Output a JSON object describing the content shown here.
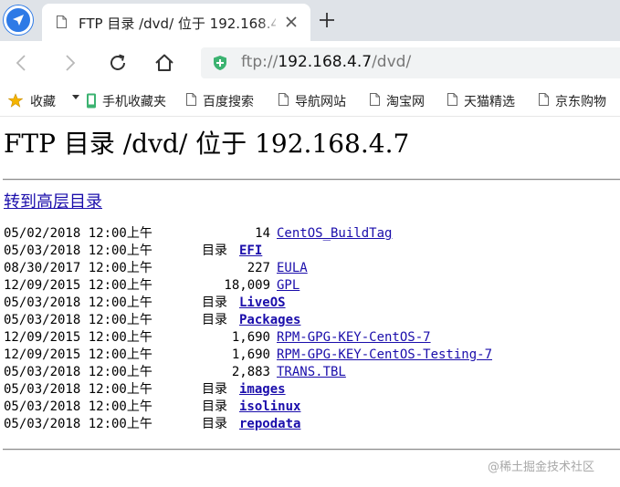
{
  "tab": {
    "title": "FTP 目录 /dvd/ 位于 192.168.4.7"
  },
  "address": {
    "scheme": "ftp://",
    "host": "192.168.4.7",
    "path": "/dvd/"
  },
  "bookmarks": [
    {
      "label": "收藏",
      "icon": "star-icon"
    },
    {
      "label": "手机收藏夹",
      "icon": "phone-icon"
    },
    {
      "label": "百度搜索",
      "icon": "page-icon"
    },
    {
      "label": "导航网站",
      "icon": "page-icon"
    },
    {
      "label": "淘宝网",
      "icon": "page-icon"
    },
    {
      "label": "天猫精选",
      "icon": "page-icon"
    },
    {
      "label": "京东购物",
      "icon": "page-icon"
    }
  ],
  "page": {
    "title": "FTP 目录 /dvd/ 位于 192.168.4.7",
    "parent_link": "转到高层目录",
    "dir_label": "目录",
    "entries": [
      {
        "date": "05/02/2018 12:00上午",
        "size": "14",
        "name": "CentOS_BuildTag",
        "is_dir": false
      },
      {
        "date": "05/03/2018 12:00上午",
        "size": "",
        "name": "EFI",
        "is_dir": true
      },
      {
        "date": "08/30/2017 12:00上午",
        "size": "227",
        "name": "EULA",
        "is_dir": false
      },
      {
        "date": "12/09/2015 12:00上午",
        "size": "18,009",
        "name": "GPL",
        "is_dir": false
      },
      {
        "date": "05/03/2018 12:00上午",
        "size": "",
        "name": "LiveOS",
        "is_dir": true
      },
      {
        "date": "05/03/2018 12:00上午",
        "size": "",
        "name": "Packages",
        "is_dir": true
      },
      {
        "date": "12/09/2015 12:00上午",
        "size": "1,690",
        "name": "RPM-GPG-KEY-CentOS-7",
        "is_dir": false
      },
      {
        "date": "12/09/2015 12:00上午",
        "size": "1,690",
        "name": "RPM-GPG-KEY-CentOS-Testing-7",
        "is_dir": false
      },
      {
        "date": "05/03/2018 12:00上午",
        "size": "2,883",
        "name": "TRANS.TBL",
        "is_dir": false
      },
      {
        "date": "05/03/2018 12:00上午",
        "size": "",
        "name": "images",
        "is_dir": true
      },
      {
        "date": "05/03/2018 12:00上午",
        "size": "",
        "name": "isolinux",
        "is_dir": true
      },
      {
        "date": "05/03/2018 12:00上午",
        "size": "",
        "name": "repodata",
        "is_dir": true
      }
    ]
  },
  "watermark": "@稀土掘金技术社区",
  "colors": {
    "link": "#1a0dab",
    "secure": "#3cb371",
    "tabstrip": "#dfe3e8"
  }
}
